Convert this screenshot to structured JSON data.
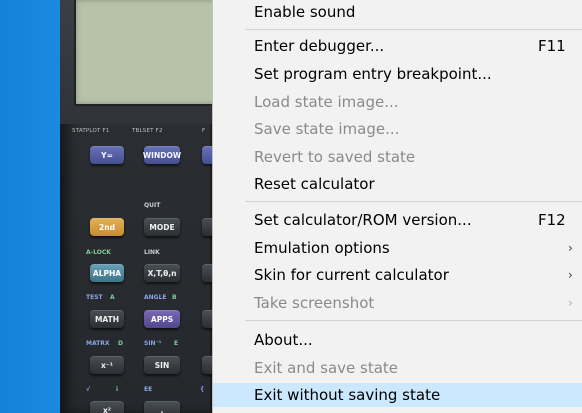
{
  "calculator": {
    "fn_labels": [
      "STATPLOT F1",
      "TBLSET F2",
      "F"
    ],
    "keys": {
      "y_equals": "Y=",
      "window": "WINDOW",
      "second": "2nd",
      "mode": "MODE",
      "alpha": "ALPHA",
      "xton": "X,T,θ,n",
      "math": "MATH",
      "apps": "APPS",
      "xinv": "x⁻¹",
      "sin": "SIN",
      "xsq": "x²",
      "comma": ","
    },
    "sublabels": {
      "quit": "QUIT",
      "alock": "A-LOCK",
      "link": "LINK",
      "test": "TEST",
      "a": "A",
      "angle": "ANGLE",
      "b": "B",
      "matrx": "MATRX",
      "d": "D",
      "sin_inv": "SIN⁻¹",
      "e": "E",
      "sqrt": "√",
      "i": "i",
      "ee": "EE",
      "brace": "{"
    }
  },
  "menu": {
    "items": [
      {
        "label": "Enable sound",
        "shortcut": "",
        "submenu": false,
        "disabled": false
      },
      {
        "label": "Enter debugger...",
        "shortcut": "F11",
        "submenu": false,
        "disabled": false
      },
      {
        "label": "Set program entry breakpoint...",
        "shortcut": "",
        "submenu": false,
        "disabled": false
      },
      {
        "label": "Load state image...",
        "shortcut": "",
        "submenu": false,
        "disabled": true
      },
      {
        "label": "Save state image...",
        "shortcut": "",
        "submenu": false,
        "disabled": true
      },
      {
        "label": "Revert to saved state",
        "shortcut": "",
        "submenu": false,
        "disabled": true
      },
      {
        "label": "Reset calculator",
        "shortcut": "",
        "submenu": false,
        "disabled": false
      },
      {
        "label": "Set calculator/ROM version...",
        "shortcut": "F12",
        "submenu": false,
        "disabled": false
      },
      {
        "label": "Emulation options",
        "shortcut": "",
        "submenu": true,
        "disabled": false
      },
      {
        "label": "Skin for current calculator",
        "shortcut": "",
        "submenu": true,
        "disabled": false
      },
      {
        "label": "Take screenshot",
        "shortcut": "",
        "submenu": true,
        "disabled": true
      },
      {
        "label": "About...",
        "shortcut": "",
        "submenu": false,
        "disabled": false
      },
      {
        "label": "Exit and save state",
        "shortcut": "",
        "submenu": false,
        "disabled": true
      },
      {
        "label": "Exit without saving state",
        "shortcut": "",
        "submenu": false,
        "disabled": false,
        "highlighted": true
      }
    ],
    "submenu_arrow": "›"
  },
  "colors": {
    "menu_background": "#f2f2f2",
    "highlight": "#cce8ff",
    "disabled_text": "#8a8a8a",
    "desktop": "#1b86d8"
  }
}
